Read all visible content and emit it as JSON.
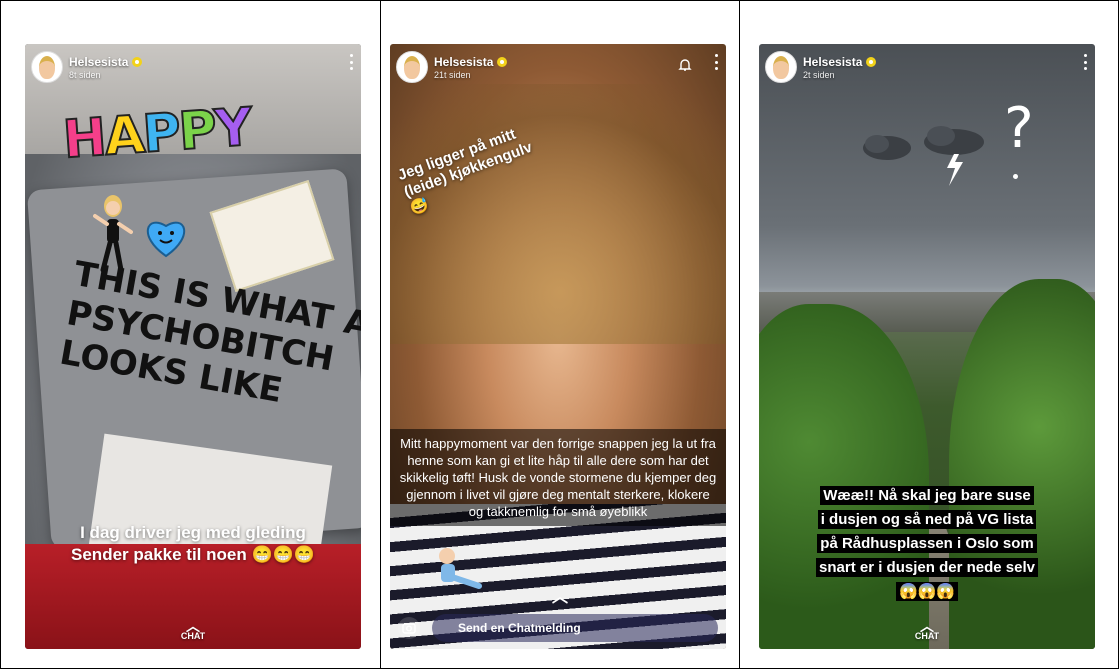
{
  "stories": [
    {
      "user": "Helsesista",
      "time": "8t siden",
      "sticker_text": "HAPPY",
      "shirt_print": [
        "THIS IS WHAT A",
        "PSYCHOBITCH",
        "LOOKS LIKE"
      ],
      "caption": [
        "I dag driver jeg med gleding",
        "Sender pakke til noen 😁😁😁"
      ],
      "chat_label": "CHAT"
    },
    {
      "user": "Helsesista",
      "time": "21t siden",
      "overlay_text": [
        "Jeg ligger på mitt",
        "(leide) kjøkkengulv",
        "😅"
      ],
      "caption": "Mitt happymoment var den forrige snappen jeg la ut fra henne som kan gi et lite håp til alle dere som har det skikkelig tøft! Husk de vonde stormene du kjemper deg gjennom i livet vil gjøre deg mentalt sterkere, klokere og takknemlig for små øyeblikk",
      "chat_placeholder": "Send en Chatmelding"
    },
    {
      "user": "Helsesista",
      "time": "2t siden",
      "caption": [
        "Wææ!! Nå skal jeg bare suse",
        "i dusjen og så ned på VG lista",
        "på Rådhusplassen i Oslo som",
        "snart er i dusjen der nede selv",
        "😱😱😱"
      ],
      "chat_label": "CHAT"
    }
  ],
  "colors": {
    "happy": [
      "#f43f8a",
      "#ffd21c",
      "#3fb4f0",
      "#7bd34a",
      "#a55ef0"
    ]
  }
}
